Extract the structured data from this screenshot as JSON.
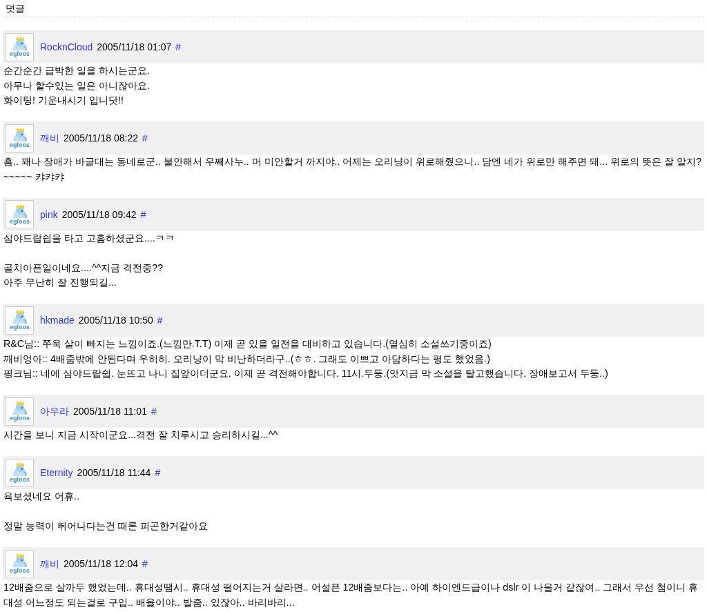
{
  "section_title": "덧글",
  "comments": [
    {
      "author": "RocknCloud",
      "date": "2005/11/18 01:07",
      "permalink": "#",
      "avatar_label": "egloos",
      "blocks": [
        [
          "순간순간 급박한 일을 하시는군요.",
          "아무나 할수있는 일은 아니잖아요.",
          "화이팅! 기운내시기 입니닷!!"
        ]
      ]
    },
    {
      "author": "깨비",
      "date": "2005/11/18 08:22",
      "permalink": "#",
      "avatar_label": "egloos",
      "blocks": [
        [
          "흠.. 꽤나 장애가 바글대는 동네로군.. 불안해서 우째사누.. 머 미안할거 까지야.. 어제는 오리냥이 위로해줬으니.. 담엔 네가 위로만 해주면 돼... 위로의 뜻은 잘 알지?~~~~~ 캬캬캬"
        ]
      ]
    },
    {
      "author": "pink",
      "date": "2005/11/18 09:42",
      "permalink": "#",
      "avatar_label": "egloos",
      "blocks": [
        [
          "심야드랍쉽을 타고 고홈하셨군요....ㅋㅋ"
        ],
        [
          "골치아픈일이네요....^^지금 격전중??",
          "아주 무난히 잘 진행되길..."
        ]
      ]
    },
    {
      "author": "hkmade",
      "date": "2005/11/18 10:50",
      "permalink": "#",
      "avatar_label": "egloos",
      "blocks": [
        [
          "R&C님:: 쭈욱 살이 빠지는 느낌이죠.(느낌만.T.T) 이제 곧 있을 일전을 대비하고 있습니다.(열심히 소설쓰기중이죠)",
          "깨비엉아:: 4배줌밖에 안된다며 우히히. 오리냥이 막 비난하더라구..(ㅎㅎ. 그래도 이쁘고 아담하다는 평도 했었음.)",
          "핑크님:: 네에 심야드랍쉽. 눈뜨고 나니 집앞이더군요. 이제 곧 격전해야합니다. 11시.두둥.(앗지금 막 소설을 탈고했습니다. 장애보고서 두둥..)"
        ]
      ]
    },
    {
      "author": "아우라",
      "date": "2005/11/18 11:01",
      "permalink": "#",
      "avatar_label": "egloos",
      "blocks": [
        [
          "시간을 보니 지금 시작이군요...격전 잘 치루시고 승리하시길...^^"
        ]
      ]
    },
    {
      "author": "Eternity",
      "date": "2005/11/18 11:44",
      "permalink": "#",
      "avatar_label": "egloos",
      "blocks": [
        [
          "욕보셨네요 어휴.."
        ],
        [
          "정말 능력이 뛰어나다는건 때론 피곤한거같아요"
        ]
      ]
    },
    {
      "author": "깨비",
      "date": "2005/11/18 12:04",
      "permalink": "#",
      "avatar_label": "egloos",
      "blocks": [
        [
          "12배줌으로 살까두 했었는데.. 휴대성땜시.. 휴대성 떨어지는거 살라면.. 어설픈 12배줌보다는.. 아예 하이엔드급이나 dslr 이 나올거 같잖여.. 그래서 우선 첨이니 휴대성 어느정도 되는걸로 구입.. 배율이야.. 발줌.. 있잖아.. 바리바리..."
        ]
      ]
    }
  ]
}
